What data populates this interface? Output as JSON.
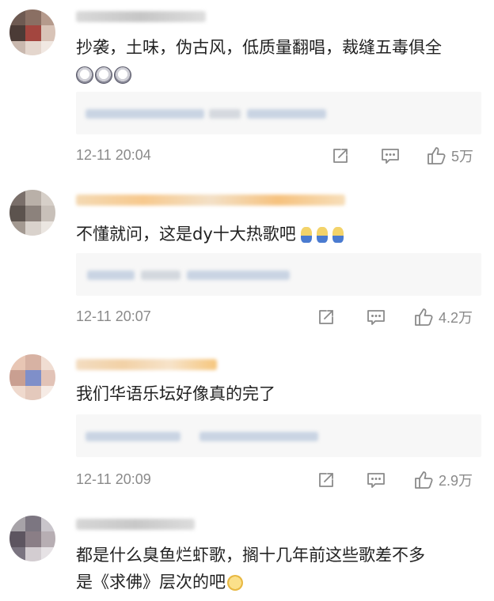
{
  "comments": [
    {
      "text": "抄袭，土味，伪古风，低质量翻唱，裁缝五毒俱全",
      "emojis": [
        "dog-face",
        "dog-face",
        "dog-face"
      ],
      "timestamp": "12-11 20:04",
      "likes": "5万"
    },
    {
      "text": "不懂就问，这是dy十大热歌吧",
      "emojis": [
        "crying",
        "crying",
        "crying"
      ],
      "timestamp": "12-11 20:07",
      "likes": "4.2万"
    },
    {
      "text": "我们华语乐坛好像真的完了",
      "emojis": [],
      "timestamp": "12-11 20:09",
      "likes": "2.9万"
    },
    {
      "text_line1": "都是什么臭鱼烂虾歌，搁十几年前这些歌差不多",
      "text_line2": "是《求佛》层次的吧",
      "emojis": [
        "praying"
      ]
    }
  ],
  "icons": {
    "share": "share-icon",
    "comment": "comment-icon",
    "like": "thumbs-up-icon"
  },
  "colors": {
    "text": "#222222",
    "meta": "#8a8a8a",
    "reply_bg": "#f7f7f7",
    "icon": "#8a8a8a"
  }
}
